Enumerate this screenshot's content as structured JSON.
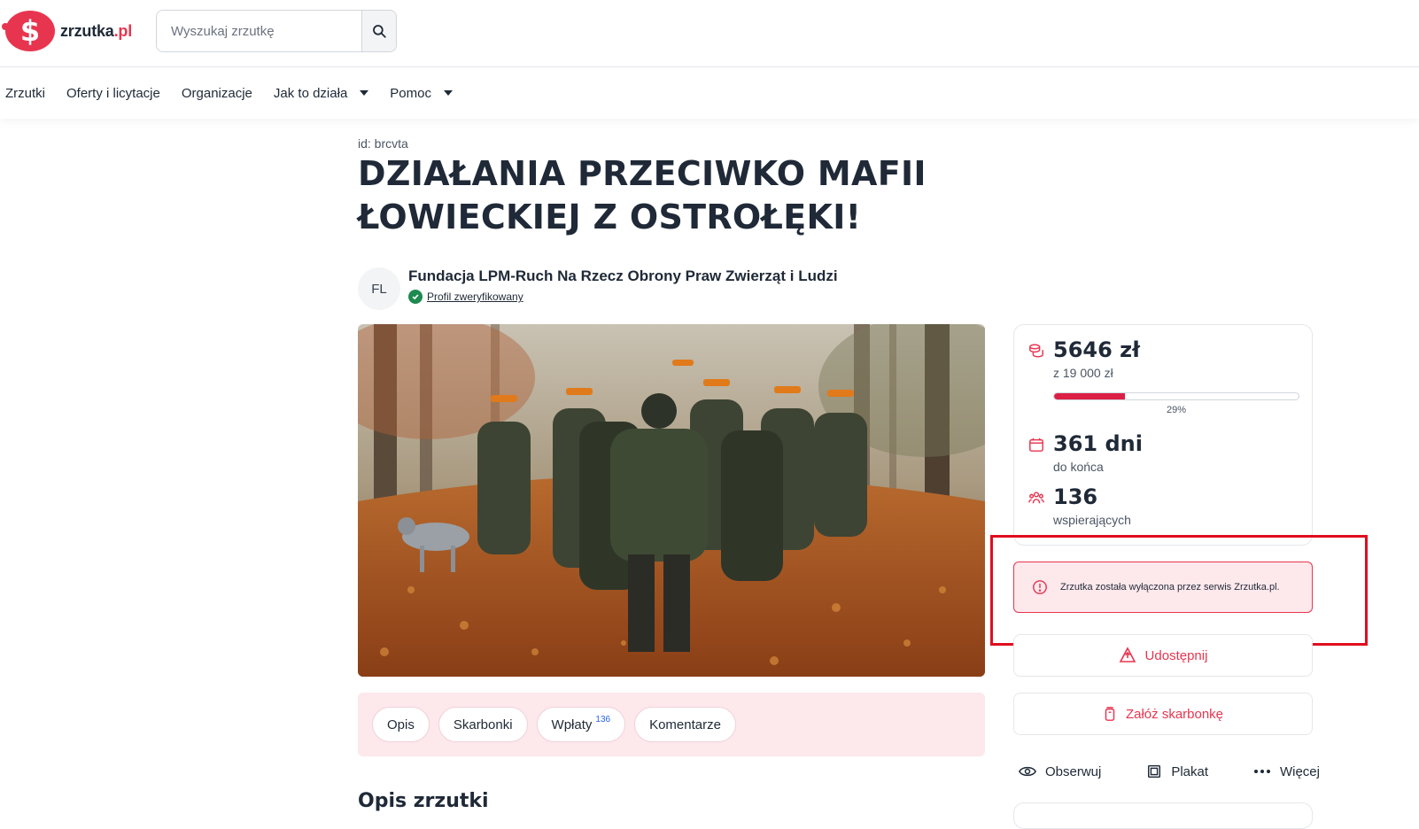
{
  "brand": {
    "name": "zrzutka",
    "tld": ".pl",
    "accent": "#e8354f"
  },
  "search": {
    "placeholder": "Wyszukaj zrzutkę"
  },
  "nav": {
    "items": [
      "Zrzutki",
      "Oferty i licytacje",
      "Organizacje",
      "Jak to działa",
      "Pomoc"
    ]
  },
  "campaign": {
    "id_label": "id: brcvta",
    "title": "DZIAŁANIA PRZECIWKO MAFII ŁOWIECKIEJ Z OSTROŁĘKI!",
    "organizer_initials": "FL",
    "organizer_name": "Fundacja LPM-Ruch Na Rzecz Obrony Praw Zwierząt i Ludzi",
    "verified_label": "Profil zweryfikowany",
    "image_alt": "hunters-walking-forest-photo"
  },
  "tabs": {
    "opis": "Opis",
    "skarbonki": "Skarbonki",
    "wplaty": "Wpłaty",
    "wplaty_count": "136",
    "komentarze": "Komentarze"
  },
  "section_title": "Opis zrzutki",
  "stats": {
    "amount": "5646 zł",
    "goal": "z 19 000 zł",
    "progress_fraction": 0.29,
    "progress_label": "29%",
    "days": "361 dni",
    "days_label": "do końca",
    "supporters": "136",
    "supporters_label": "wspierających",
    "progress_color": "#dc1f45"
  },
  "alert": {
    "text": "Zrzutka została wyłączona przez serwis Zrzutka.pl."
  },
  "buttons": {
    "share": "Udostępnij",
    "create_box": "Załóż skarbonkę",
    "watch": "Obserwuj",
    "poster": "Plakat",
    "more": "Więcej"
  }
}
